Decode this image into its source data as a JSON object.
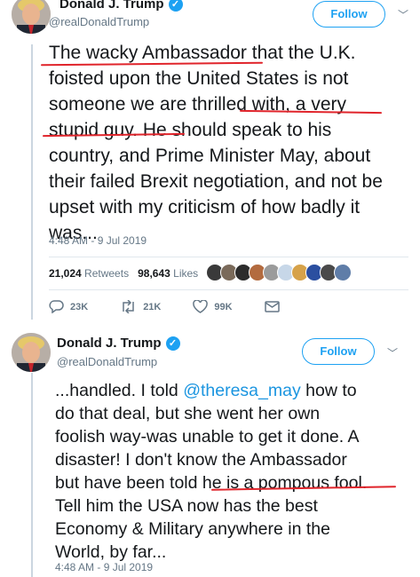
{
  "tweets": [
    {
      "author_name": "Donald J. Trump",
      "author_handle": "@realDonaldTrump",
      "verified": true,
      "follow_label": "Follow",
      "text_lines": [
        "The wacky Ambassador that the U.K.",
        "foisted upon the United States is not",
        "someone we are thrilled with, a very",
        "stupid guy. He should speak to his",
        "country, and Prime Minister May, about",
        "their failed Brexit negotiation, and not be",
        "upset with my criticism of how badly it",
        "was..."
      ],
      "timestamp": "4:48 AM - 9 Jul 2019",
      "retweets_count": "21,024",
      "retweets_label": "Retweets",
      "likes_count": "98,643",
      "likes_label": "Likes",
      "actions": {
        "reply": "23K",
        "retweet": "21K",
        "like": "99K"
      }
    },
    {
      "author_name": "Donald J. Trump",
      "author_handle": "@realDonaldTrump",
      "verified": true,
      "follow_label": "Follow",
      "text_lines": [
        {
          "before": "...handled. I told ",
          "mention": "@theresa_may",
          "after": " how to"
        },
        "do that deal, but she went her own",
        "foolish way-was unable to get it done. A",
        "disaster! I don't know the Ambassador",
        "but have been told he is a pompous fool.",
        "Tell him the USA now has the best",
        "Economy & Military  anywhere in the",
        "World, by far..."
      ],
      "timestamp": "4:48 AM - 9 Jul 2019"
    }
  ],
  "colors": {
    "accent": "#1da1f2",
    "underline": "#e0242b",
    "muted": "#657786"
  }
}
